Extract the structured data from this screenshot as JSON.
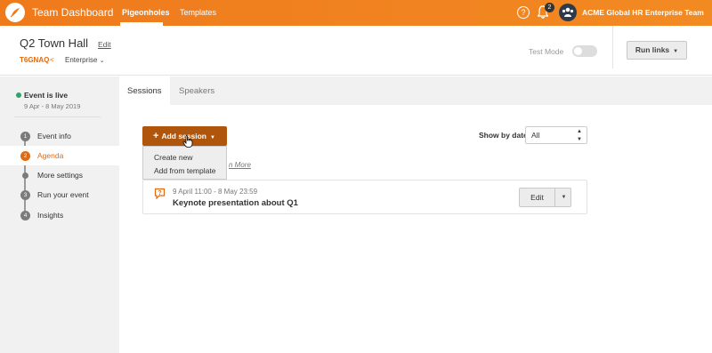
{
  "topbar": {
    "app_title": "Team Dashboard",
    "nav": [
      {
        "label": "Pigeonholes",
        "active": true
      },
      {
        "label": "Templates",
        "active": false
      }
    ],
    "help_glyph": "?",
    "notification_count": "2",
    "team_name": "ACME Global HR Enterprise Team",
    "brand_color": "#f28a22"
  },
  "event": {
    "title": "Q2 Town Hall",
    "edit_label": "Edit",
    "code": "T6GNAQ",
    "plan": "Enterprise",
    "test_mode_label": "Test Mode",
    "test_mode_on": false,
    "run_links_label": "Run links"
  },
  "sidebar": {
    "status": "Event is live",
    "dates": "9 Apr - 8 May 2019",
    "steps": [
      {
        "num": "1",
        "label": "Event info",
        "active": false
      },
      {
        "num": "2",
        "label": "Agenda",
        "active": true
      },
      {
        "num": "",
        "label": "More settings",
        "active": false
      },
      {
        "num": "3",
        "label": "Run your event",
        "active": false
      },
      {
        "num": "4",
        "label": "Insights",
        "active": false
      }
    ]
  },
  "tabs": [
    {
      "label": "Sessions",
      "active": true
    },
    {
      "label": "Speakers",
      "active": false
    }
  ],
  "main": {
    "add_session_label": "Add session",
    "dropdown": [
      "Create new",
      "Add from template"
    ],
    "learn_more_partial": "n More",
    "show_by_date_label": "Show by date",
    "date_filter_value": "All",
    "sessions": [
      {
        "time": "9 April 11:00 - 8 May 23:59",
        "title": "Keynote presentation about Q1",
        "edit_label": "Edit"
      }
    ]
  }
}
